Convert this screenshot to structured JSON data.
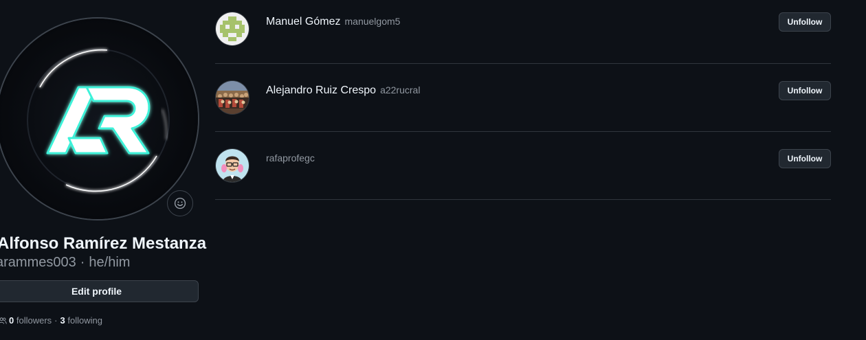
{
  "profile": {
    "avatar_icon": "ar-monogram-logo",
    "status_icon": "smiley-icon",
    "full_name": "Alfonso Ramírez Mestanza",
    "login": "arammes003",
    "separator": "·",
    "pronouns": "he/him",
    "edit_profile_label": "Edit profile",
    "followers_count": "0",
    "followers_label": "followers",
    "stats_separator": "·",
    "following_count": "3",
    "following_label": "following"
  },
  "following": [
    {
      "display_name": "Manuel Gómez",
      "login": "manuelgom5",
      "avatar_icon": "identicon-avatar",
      "button_label": "Unfollow"
    },
    {
      "display_name": "Alejandro Ruiz Crespo",
      "login": "a22rucral",
      "avatar_icon": "photo-avatar",
      "button_label": "Unfollow"
    },
    {
      "display_name": "",
      "login": "rafaprofegc",
      "avatar_icon": "cartoon-avatar",
      "button_label": "Unfollow"
    }
  ],
  "colors": {
    "background": "#0d1117",
    "border": "#30363d",
    "button_bg": "#212830",
    "text_primary": "#f0f6fc",
    "text_muted": "#9198a1",
    "logo_accent": "#3df2d9"
  }
}
